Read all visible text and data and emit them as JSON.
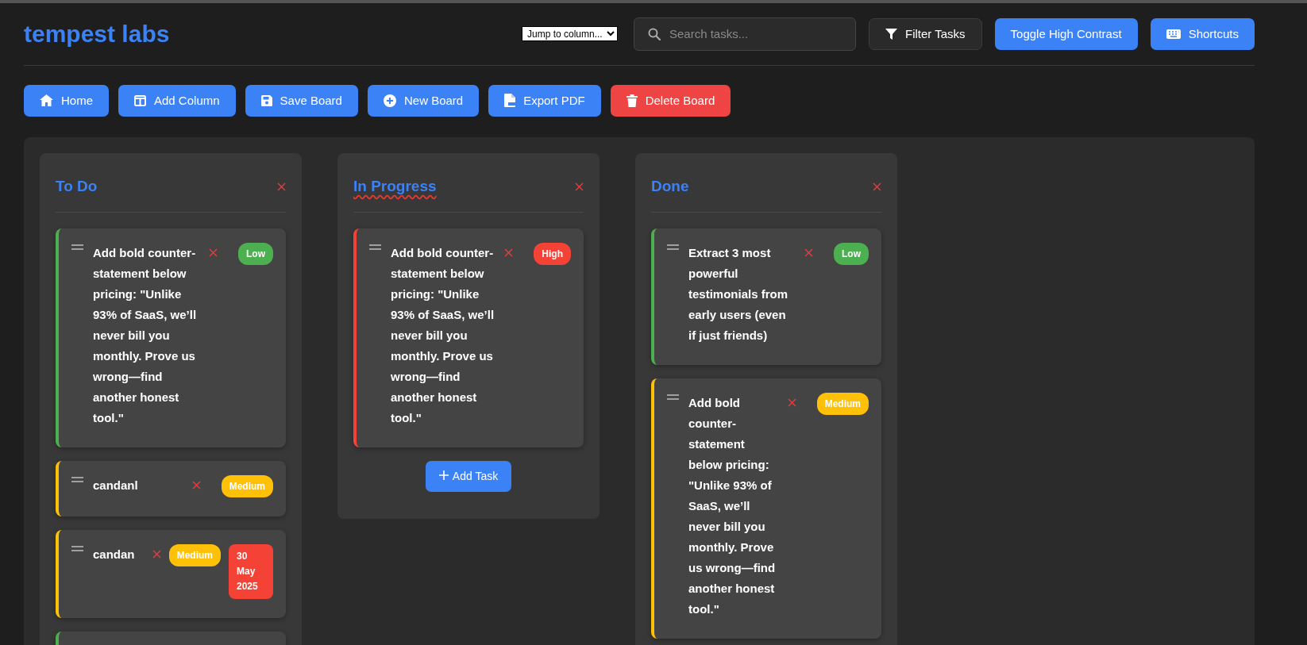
{
  "brand": "tempest labs",
  "header": {
    "jump_select": "Jump to column...",
    "search": {
      "placeholder": "Search tasks..."
    },
    "buttons": [
      {
        "label": "Filter Tasks",
        "kind": "filter"
      },
      {
        "label": "Toggle High Contrast",
        "kind": "contrast"
      },
      {
        "label": "Shortcuts",
        "kind": "shortcuts"
      }
    ]
  },
  "toolbar": [
    {
      "label": "Home",
      "kind": "home"
    },
    {
      "label": "Add Column",
      "kind": "column"
    },
    {
      "label": "Save Board",
      "kind": "save"
    },
    {
      "label": "New Board",
      "kind": "new"
    },
    {
      "label": "Export PDF",
      "kind": "pdf"
    },
    {
      "label": "Delete Board",
      "kind": "delete"
    }
  ],
  "columns": [
    {
      "title": "To Do",
      "spellcheck_flagged": false,
      "cards": [
        {
          "title": "Add bold counter-statement below pricing: \"Unlike 93% of SaaS, we’ll never bill you monthly. Prove us wrong—find another honest tool.\"",
          "color": "#4caf50",
          "badge": "Low"
        },
        {
          "title": "candanl",
          "color": "#ffc107",
          "badge": "Medium"
        },
        {
          "title": "candan",
          "color": "#ffc107",
          "badge": "Medium",
          "due": "30 May 2025"
        },
        {
          "color": "#4caf50"
        }
      ]
    },
    {
      "title": "In Progress",
      "spellcheck_flagged": true,
      "add_task": "Add Task",
      "cards": [
        {
          "title": "Add bold counter-statement below pricing: \"Unlike 93% of SaaS, we’ll never bill you monthly. Prove us wrong—find another honest tool.\"",
          "color": "#f44336",
          "badge": "High"
        }
      ]
    },
    {
      "title": "Done",
      "spellcheck_flagged": false,
      "cards": [
        {
          "title": "Extract 3 most powerful testimonials from early users (even if just friends)",
          "color": "#4caf50",
          "badge": "Low"
        },
        {
          "title": "Add bold counter-statement below pricing: \"Unlike 93% of SaaS, we’ll never bill you monthly. Prove us wrong—find another honest tool.\"",
          "color": "#ffc107",
          "badge": "Medium"
        }
      ]
    }
  ]
}
